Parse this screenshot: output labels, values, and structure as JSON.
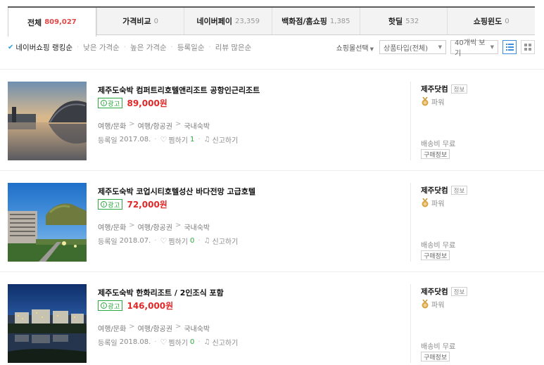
{
  "tabs": [
    {
      "label": "전체",
      "count": "809,027",
      "active": true
    },
    {
      "label": "가격비교",
      "count": "0"
    },
    {
      "label": "네이버페이",
      "count": "23,359"
    },
    {
      "label": "백화점/홈쇼핑",
      "count": "1,385"
    },
    {
      "label": "핫딜",
      "count": "532"
    },
    {
      "label": "쇼핑윈도",
      "count": "0"
    }
  ],
  "sort": {
    "items": [
      "네이버쇼핑 랭킹순",
      "낮은 가격순",
      "높은 가격순",
      "등록일순",
      "리뷰 많은순"
    ],
    "mall_select_label": "쇼핑몰선택",
    "type_dropdown": "상품타입(전체)",
    "count_dropdown": "40개씩 보기"
  },
  "products": [
    {
      "title": "제주도숙박 컴퍼트리호텔앤리조트 공항인근리조트",
      "ad_label": "광고",
      "ad_icon": "i",
      "price": "89,000원",
      "category": [
        "여행/문화",
        "여행/항공권",
        "국내숙박"
      ],
      "reg_label": "등록일",
      "reg_date": "2017.08.",
      "zzim_label": "찜하기",
      "zzim_count": "1",
      "report_label": "신고하기",
      "mall": "제주닷컴",
      "info_label": "정보",
      "grade": "파워",
      "shipping": "배송비 무료",
      "buy_info": "구매정보"
    },
    {
      "title": "제주도숙박 코업시티호텔성산 바다전망 고급호텔",
      "ad_label": "광고",
      "ad_icon": "i",
      "price": "72,000원",
      "category": [
        "여행/문화",
        "여행/항공권",
        "국내숙박"
      ],
      "reg_label": "등록일",
      "reg_date": "2018.07.",
      "zzim_label": "찜하기",
      "zzim_count": "0",
      "report_label": "신고하기",
      "mall": "제주닷컴",
      "info_label": "정보",
      "grade": "파워",
      "shipping": "배송비 무료",
      "buy_info": "구매정보"
    },
    {
      "title": "제주도숙박 한화리조트 / 2인조식 포함",
      "ad_label": "광고",
      "ad_icon": "i",
      "price": "146,000원",
      "category": [
        "여행/문화",
        "여행/항공권",
        "국내숙박"
      ],
      "reg_label": "등록일",
      "reg_date": "2018.08.",
      "zzim_label": "찜하기",
      "zzim_count": "0",
      "report_label": "신고하기",
      "mall": "제주닷컴",
      "info_label": "정보",
      "grade": "파워",
      "shipping": "배송비 무료",
      "buy_info": "구매정보"
    }
  ],
  "icons": {
    "check": "checkmark-icon",
    "heart": "heart-icon",
    "bell": "report-bell-icon",
    "medal": "power-grade-medal-icon",
    "list_view": "list-view-icon",
    "grid_view": "grid-view-icon"
  },
  "colors": {
    "accent": "#2c9ce0",
    "price": "#e02828",
    "ad": "#2aa83e",
    "active_count": "#e04646"
  }
}
